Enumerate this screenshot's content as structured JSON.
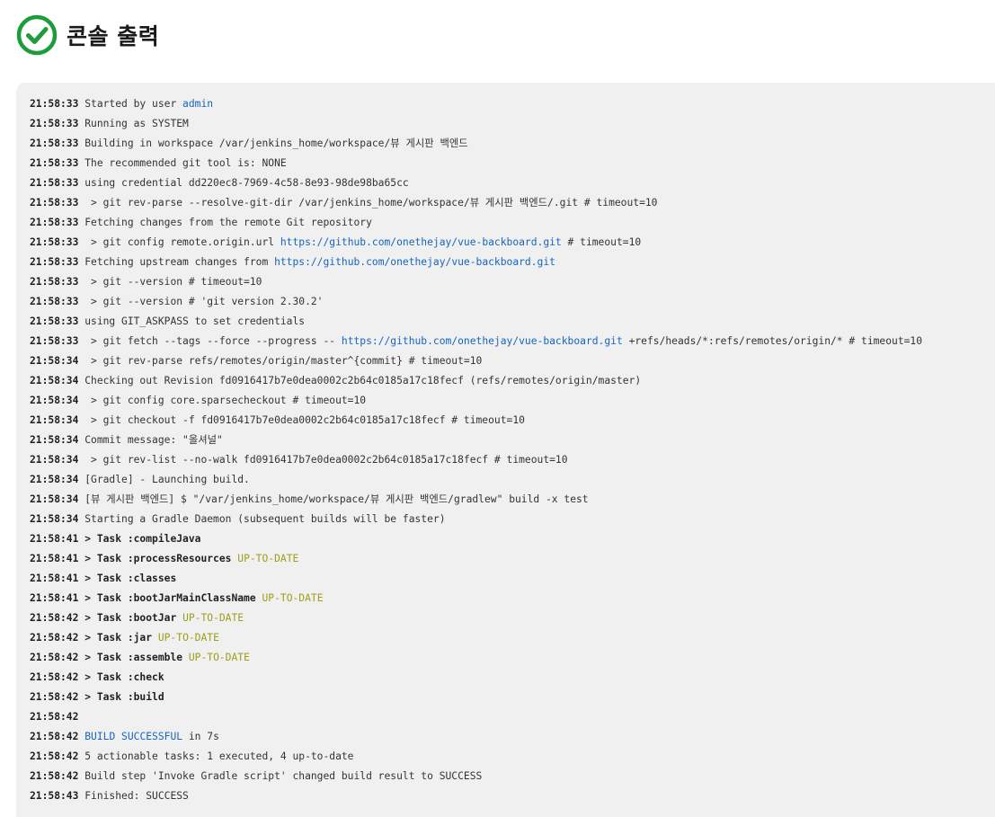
{
  "header": {
    "title": "콘솔 출력",
    "status_icon": "success-check-icon",
    "status_color": "#1e9c3b"
  },
  "colors": {
    "link": "#1565c0",
    "up_to_date": "#9e9e1a",
    "console_background": "#f0f0f0"
  },
  "console": {
    "lines": [
      {
        "ts": "21:58:33",
        "segs": [
          {
            "t": " Started by user "
          },
          {
            "t": "admin",
            "k": "link"
          }
        ]
      },
      {
        "ts": "21:58:33",
        "segs": [
          {
            "t": " Running as SYSTEM"
          }
        ]
      },
      {
        "ts": "21:58:33",
        "segs": [
          {
            "t": " Building in workspace /var/jenkins_home/workspace/뷰 게시판 백엔드"
          }
        ]
      },
      {
        "ts": "21:58:33",
        "segs": [
          {
            "t": " The recommended git tool is: NONE"
          }
        ]
      },
      {
        "ts": "21:58:33",
        "segs": [
          {
            "t": " using credential dd220ec8-7969-4c58-8e93-98de98ba65cc"
          }
        ]
      },
      {
        "ts": "21:58:33",
        "segs": [
          {
            "t": "  > git rev-parse --resolve-git-dir /var/jenkins_home/workspace/뷰 게시판 백엔드/.git # timeout=10"
          }
        ]
      },
      {
        "ts": "21:58:33",
        "segs": [
          {
            "t": " Fetching changes from the remote Git repository"
          }
        ]
      },
      {
        "ts": "21:58:33",
        "segs": [
          {
            "t": "  > git config remote.origin.url "
          },
          {
            "t": "https://github.com/onethejay/vue-backboard.git",
            "k": "link"
          },
          {
            "t": " # timeout=10"
          }
        ]
      },
      {
        "ts": "21:58:33",
        "segs": [
          {
            "t": " Fetching upstream changes from "
          },
          {
            "t": "https://github.com/onethejay/vue-backboard.git",
            "k": "link"
          }
        ]
      },
      {
        "ts": "21:58:33",
        "segs": [
          {
            "t": "  > git --version # timeout=10"
          }
        ]
      },
      {
        "ts": "21:58:33",
        "segs": [
          {
            "t": "  > git --version # 'git version 2.30.2'"
          }
        ]
      },
      {
        "ts": "21:58:33",
        "segs": [
          {
            "t": " using GIT_ASKPASS to set credentials"
          }
        ]
      },
      {
        "ts": "21:58:33",
        "segs": [
          {
            "t": "  > git fetch --tags --force --progress -- "
          },
          {
            "t": "https://github.com/onethejay/vue-backboard.git",
            "k": "link"
          },
          {
            "t": " +refs/heads/*:refs/remotes/origin/* # timeout=10"
          }
        ]
      },
      {
        "ts": "21:58:34",
        "segs": [
          {
            "t": "  > git rev-parse refs/remotes/origin/master^{commit} # timeout=10"
          }
        ]
      },
      {
        "ts": "21:58:34",
        "segs": [
          {
            "t": " Checking out Revision fd0916417b7e0dea0002c2b64c0185a17c18fecf (refs/remotes/origin/master)"
          }
        ]
      },
      {
        "ts": "21:58:34",
        "segs": [
          {
            "t": "  > git config core.sparsecheckout # timeout=10"
          }
        ]
      },
      {
        "ts": "21:58:34",
        "segs": [
          {
            "t": "  > git checkout -f fd0916417b7e0dea0002c2b64c0185a17c18fecf # timeout=10"
          }
        ]
      },
      {
        "ts": "21:58:34",
        "segs": [
          {
            "t": " Commit message: \"올셔널\""
          }
        ]
      },
      {
        "ts": "21:58:34",
        "segs": [
          {
            "t": "  > git rev-list --no-walk fd0916417b7e0dea0002c2b64c0185a17c18fecf # timeout=10"
          }
        ]
      },
      {
        "ts": "21:58:34",
        "segs": [
          {
            "t": " [Gradle] - Launching build."
          }
        ]
      },
      {
        "ts": "21:58:34",
        "segs": [
          {
            "t": " [뷰 게시판 백엔드] $ \"/var/jenkins_home/workspace/뷰 게시판 백엔드/gradlew\" build -x test"
          }
        ]
      },
      {
        "ts": "21:58:34",
        "segs": [
          {
            "t": " Starting a Gradle Daemon (subsequent builds will be faster)"
          }
        ]
      },
      {
        "ts": "21:58:41",
        "segs": [
          {
            "t": " > Task :compileJava",
            "k": "bold"
          }
        ]
      },
      {
        "ts": "21:58:41",
        "segs": [
          {
            "t": " > Task :processResources",
            "k": "bold"
          },
          {
            "t": " "
          },
          {
            "t": "UP-TO-DATE",
            "k": "uptodate"
          }
        ]
      },
      {
        "ts": "21:58:41",
        "segs": [
          {
            "t": " > Task :classes",
            "k": "bold"
          }
        ]
      },
      {
        "ts": "21:58:41",
        "segs": [
          {
            "t": " > Task :bootJarMainClassName",
            "k": "bold"
          },
          {
            "t": " "
          },
          {
            "t": "UP-TO-DATE",
            "k": "uptodate"
          }
        ]
      },
      {
        "ts": "21:58:42",
        "segs": [
          {
            "t": " > Task :bootJar",
            "k": "bold"
          },
          {
            "t": " "
          },
          {
            "t": "UP-TO-DATE",
            "k": "uptodate"
          }
        ]
      },
      {
        "ts": "21:58:42",
        "segs": [
          {
            "t": " > Task :jar",
            "k": "bold"
          },
          {
            "t": " "
          },
          {
            "t": "UP-TO-DATE",
            "k": "uptodate"
          }
        ]
      },
      {
        "ts": "21:58:42",
        "segs": [
          {
            "t": " > Task :assemble",
            "k": "bold"
          },
          {
            "t": " "
          },
          {
            "t": "UP-TO-DATE",
            "k": "uptodate"
          }
        ]
      },
      {
        "ts": "21:58:42",
        "segs": [
          {
            "t": " > Task :check",
            "k": "bold"
          }
        ]
      },
      {
        "ts": "21:58:42",
        "segs": [
          {
            "t": " > Task :build",
            "k": "bold"
          }
        ]
      },
      {
        "ts": "21:58:42",
        "segs": []
      },
      {
        "ts": "21:58:42",
        "segs": [
          {
            "t": " "
          },
          {
            "t": "BUILD SUCCESSFUL",
            "k": "success"
          },
          {
            "t": " in 7s"
          }
        ]
      },
      {
        "ts": "21:58:42",
        "segs": [
          {
            "t": " 5 actionable tasks: 1 executed, 4 up-to-date"
          }
        ]
      },
      {
        "ts": "21:58:42",
        "segs": [
          {
            "t": " Build step 'Invoke Gradle script' changed build result to SUCCESS"
          }
        ]
      },
      {
        "ts": "21:58:43",
        "segs": [
          {
            "t": " Finished: SUCCESS"
          }
        ]
      }
    ]
  }
}
